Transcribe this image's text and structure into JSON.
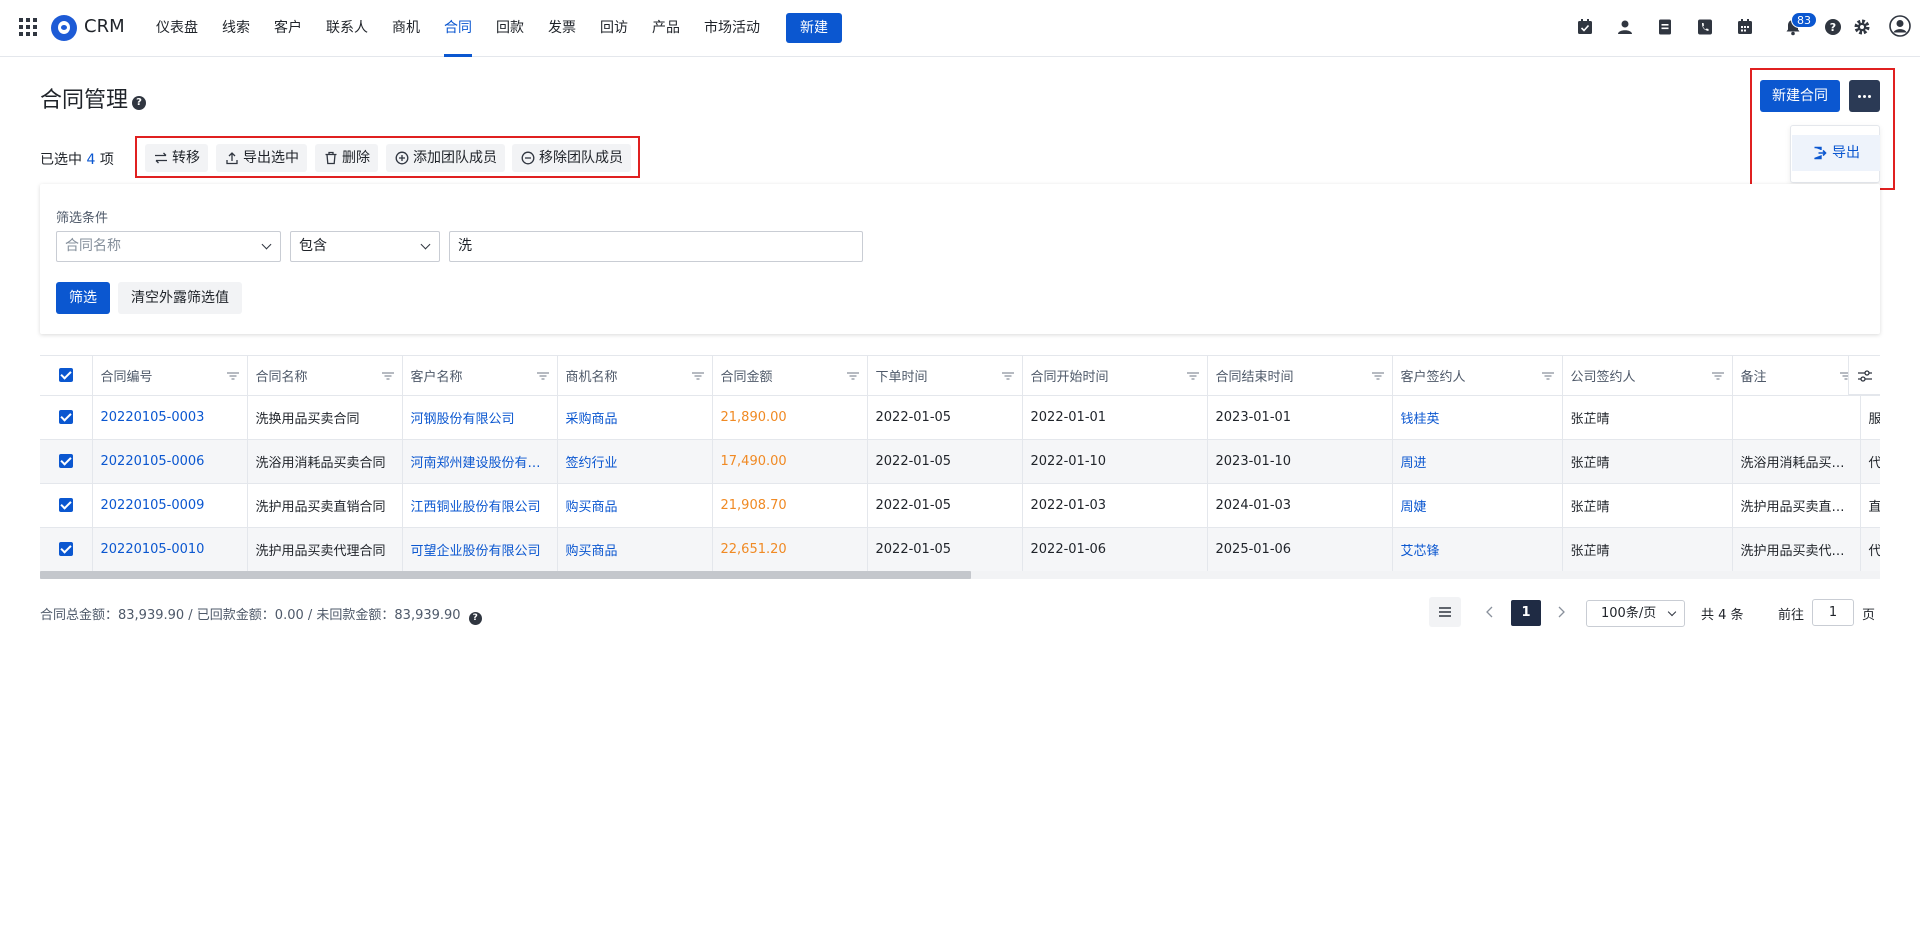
{
  "app": {
    "brand": "CRM"
  },
  "nav": {
    "items": [
      "仪表盘",
      "线索",
      "客户",
      "联系人",
      "商机",
      "合同",
      "回款",
      "发票",
      "回访",
      "产品",
      "市场活动"
    ],
    "active": "合同",
    "new_label": "新建",
    "notification_count": "83"
  },
  "page": {
    "title": "合同管理",
    "new_contract_label": "新建合同",
    "more_menu": {
      "export_label": "导出"
    }
  },
  "selection": {
    "prefix": "已选中",
    "count": "4",
    "suffix": "项",
    "actions": [
      "转移",
      "导出选中",
      "删除",
      "添加团队成员",
      "移除团队成员"
    ]
  },
  "filter": {
    "label": "筛选条件",
    "field_placeholder": "合同名称",
    "operator": "包含",
    "value": "洗",
    "apply_label": "筛选",
    "clear_label": "清空外露筛选值"
  },
  "table": {
    "columns": [
      "合同编号",
      "合同名称",
      "客户名称",
      "商机名称",
      "合同金额",
      "下单时间",
      "合同开始时间",
      "合同结束时间",
      "客户签约人",
      "公司签约人",
      "备注",
      ""
    ],
    "rows": [
      [
        "20220105-0003",
        "洗换用品买卖合同",
        "河钢股份有限公司",
        "采购商品",
        "21,890.00",
        "2022-01-05",
        "2022-01-01",
        "2023-01-01",
        "钱桂英",
        "张芷晴",
        "",
        "服"
      ],
      [
        "20220105-0006",
        "洗浴用消耗品买卖合同",
        "河南郑州建设股份有限公司",
        "签约行业",
        "17,490.00",
        "2022-01-05",
        "2022-01-10",
        "2023-01-10",
        "周进",
        "张芷晴",
        "洗浴用消耗品买卖合同",
        "代"
      ],
      [
        "20220105-0009",
        "洗护用品买卖直销合同",
        "江西铜业股份有限公司",
        "购买商品",
        "21,908.70",
        "2022-01-05",
        "2022-01-03",
        "2024-01-03",
        "周婕",
        "张芷晴",
        "洗护用品买卖直销合同",
        "直"
      ],
      [
        "20220105-0010",
        "洗护用品买卖代理合同",
        "可望企业股份有限公司",
        "购买商品",
        "22,651.20",
        "2022-01-05",
        "2022-01-06",
        "2025-01-06",
        "艾芯锋",
        "张芷晴",
        "洗护用品买卖代理合同",
        "代"
      ]
    ]
  },
  "totals": "合同总金额：83,939.90 / 已回款金额：0.00 / 未回款金额：83,939.90",
  "pagination": {
    "current": "1",
    "page_size": "100条/页",
    "total": "共 4 条",
    "goto_label": "前往",
    "goto_value": "1",
    "page_suffix": "页"
  },
  "colors": {
    "primary": "#0b57d0",
    "amount": "#f08a24",
    "dark_button": "#2b3a55",
    "highlight_box": "#e02020"
  }
}
